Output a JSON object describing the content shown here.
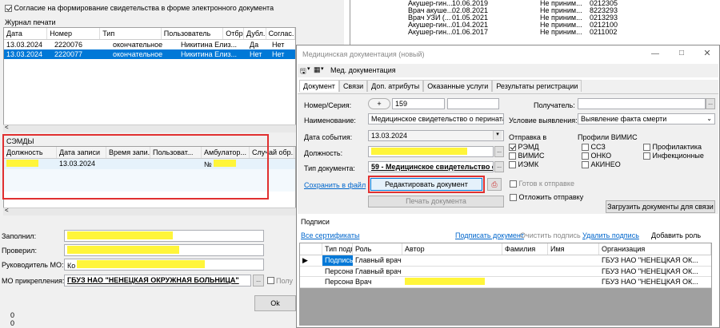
{
  "left": {
    "consent_checkbox_label": "Согласие на формирование свидетельства в форме электронного документа",
    "journal_title": "Журнал печати",
    "journal_columns": [
      "Дата",
      "Номер",
      "Тип",
      "Пользователь",
      "Отбр...",
      "Дубл...",
      "Соглас..."
    ],
    "journal_rows": [
      [
        "13.03.2024",
        "2220076",
        "окончательное",
        "Никитина Елиз...",
        "Да",
        "Нет",
        ""
      ],
      [
        "13.03.2024",
        "2220077",
        "окончательное",
        "Никитина Елиз...",
        "Нет",
        "Нет",
        ""
      ]
    ],
    "semd_title": "СЭМДЫ",
    "semd_columns": [
      "Должность",
      "Дата записи",
      "Время запи...",
      "Пользоват...",
      "Амбулатор...",
      "Случай обр..."
    ],
    "semd_rows": [
      [
        "",
        "13.03.2024",
        "",
        "",
        "№",
        ""
      ]
    ],
    "filled_label": "Заполнил:",
    "checked_label": "Проверил:",
    "head_label": "Руководитель МО:",
    "head_value": "Ко",
    "mo_label": "МО прикрепления:",
    "mo_value": "ГБУЗ НАО \"НЕНЕЦКАЯ ОКРУЖНАЯ БОЛЬНИЦА\"",
    "mo_trailing": "Полу",
    "ok_label": "Ok",
    "zeros": [
      "0",
      "0"
    ]
  },
  "background_list": {
    "rows": [
      [
        "Акушер-гин...",
        "10.06.2019",
        "Не приним...",
        "0212305"
      ],
      [
        "Врач акуше...",
        "02.08.2021",
        "Не приним...",
        "8223293"
      ],
      [
        "Врач УЗИ (...",
        "01.05.2021",
        "Не приним...",
        "0213293"
      ],
      [
        "Акушер-гин...",
        "01.04.2021",
        "Не приним...",
        "0212100"
      ],
      [
        "Акушер-гин...",
        "01.06.2017",
        "Не приним...",
        "0211002"
      ]
    ]
  },
  "dialog": {
    "title": "Медицинская документация (новый)",
    "toolbar_label": "Мед. документация",
    "tabs": [
      "Документ",
      "Связи",
      "Доп. атрибуты",
      "Оказанные услуги",
      "Результаты регистрации"
    ],
    "number_label": "Номер/Серия:",
    "number_plus": "+",
    "number_value": "159",
    "recipient_label": "Получатель:",
    "name_label": "Наименование:",
    "name_value": "Медицинское свидетельство о перинаталь",
    "condition_label": "Условие выявления:",
    "condition_value": "Выявление факта смерти",
    "event_date_label": "Дата события:",
    "event_date_value": "13.03.2024",
    "send_to_label": "Отправка в",
    "vimis_profiles_label": "Профили ВИМИС",
    "position_label": "Должность:",
    "doc_type_label": "Тип документа:",
    "doc_type_value": "59 - Медицинское свидетельство о",
    "send_options": [
      {
        "label": "РЭМД",
        "checked": true
      },
      {
        "label": "ВИМИС",
        "checked": false
      },
      {
        "label": "ИЭМК",
        "checked": false
      }
    ],
    "profiles_col1": [
      "ССЗ",
      "ОНКО",
      "АКИНЕО"
    ],
    "profiles_col2": [
      "Профилактика",
      "Инфекционные"
    ],
    "save_to_file": "Сохранить в файл",
    "edit_doc_button": "Редактировать документ",
    "print_doc_button": "Печать документа",
    "ready_to_send": "Готов к отправке",
    "postpone_send": "Отложить отправку",
    "load_docs_button": "Загрузить документы для связи",
    "signatures_title": "Подписи",
    "all_certs": "Все сертификаты",
    "sign_doc": "Подписать документ",
    "clear_sign": "Очистить подпись",
    "delete_sign": "Удалить подпись",
    "add_role": "Добавить роль",
    "sig_columns": [
      "Тип подписи",
      "Роль",
      "Автор",
      "Фамилия",
      "Имя",
      "Организация"
    ],
    "sig_rows": [
      [
        "Подпись ме...",
        "Главный врач",
        "",
        "",
        "",
        "ГБУЗ НАО \"НЕНЕЦКАЯ ОК..."
      ],
      [
        "Персональн...",
        "Главный врач",
        "",
        "",
        "",
        "ГБУЗ НАО \"НЕНЕЦКАЯ ОК..."
      ],
      [
        "Персональн...",
        "Врач",
        "",
        "",
        "",
        "ГБУЗ НАО \"НЕНЕЦКАЯ ОК..."
      ]
    ]
  }
}
